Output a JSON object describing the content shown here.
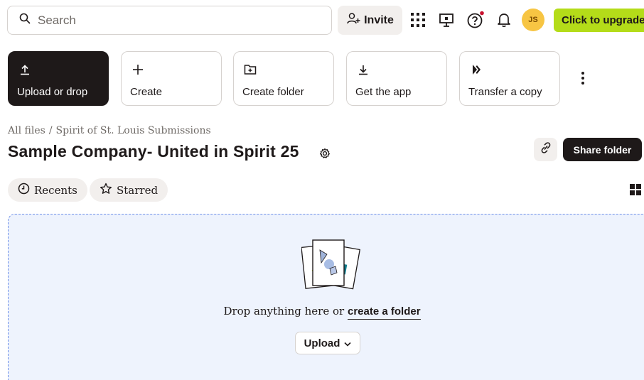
{
  "search": {
    "placeholder": "Search"
  },
  "topbar": {
    "invite_label": "Invite",
    "avatar_initials": "JS",
    "upgrade_label": "Click to upgrade",
    "accent_color": "#b4dc19",
    "notification_dot_color": "#c8102e"
  },
  "actions": [
    {
      "label": "Upload or drop",
      "icon": "upload-icon"
    },
    {
      "label": "Create",
      "icon": "plus-icon"
    },
    {
      "label": "Create folder",
      "icon": "folder-plus-icon"
    },
    {
      "label": "Get the app",
      "icon": "download-icon"
    },
    {
      "label": "Transfer a copy",
      "icon": "transfer-icon"
    }
  ],
  "breadcrumb": {
    "root": "All files",
    "separator": "/",
    "parent": "Spirit of St. Louis Submissions"
  },
  "page": {
    "title": "Sample Company- United in Spirit 25"
  },
  "share_label": "Share folder",
  "filters": [
    {
      "label": "Recents",
      "icon": "clock-icon"
    },
    {
      "label": "Starred",
      "icon": "star-icon"
    }
  ],
  "dropzone": {
    "text": "Drop anything here or",
    "link_label": "create a folder",
    "upload_label": "Upload"
  }
}
